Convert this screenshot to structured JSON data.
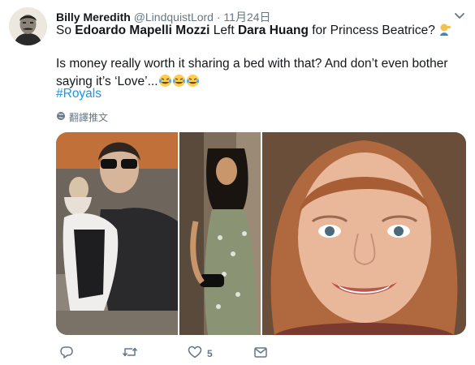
{
  "tweet": {
    "author_name": "Billy Meredith",
    "handle": "@LindquistLord",
    "separator": "·",
    "timestamp": "11月24日",
    "line1_prefix": "So ",
    "line1_name1": "Edoardo Mapelli Mozzi",
    "line1_mid": " Left ",
    "line1_name2": "Dara Huang",
    "line1_suffix": " for Princess Beatrice?",
    "line2": "Is money really worth it sharing a bed with that? And don’t even bother saying it’s ‘Love’...",
    "hashtag": "#Royals",
    "translate_label": "翻譯推文",
    "like_count": "5"
  },
  "icons": {
    "caret": "chevron-down-icon",
    "globe": "globe-icon",
    "reply": "reply-icon",
    "retweet": "retweet-icon",
    "like": "heart-icon",
    "dm": "envelope-icon",
    "emoji_facepalm": "person-facepalming-emoji",
    "emoji_laugh": "face-with-tears-of-joy-emoji"
  },
  "colors": {
    "link": "#1b95e0",
    "muted": "#657786",
    "text": "#14171a"
  }
}
